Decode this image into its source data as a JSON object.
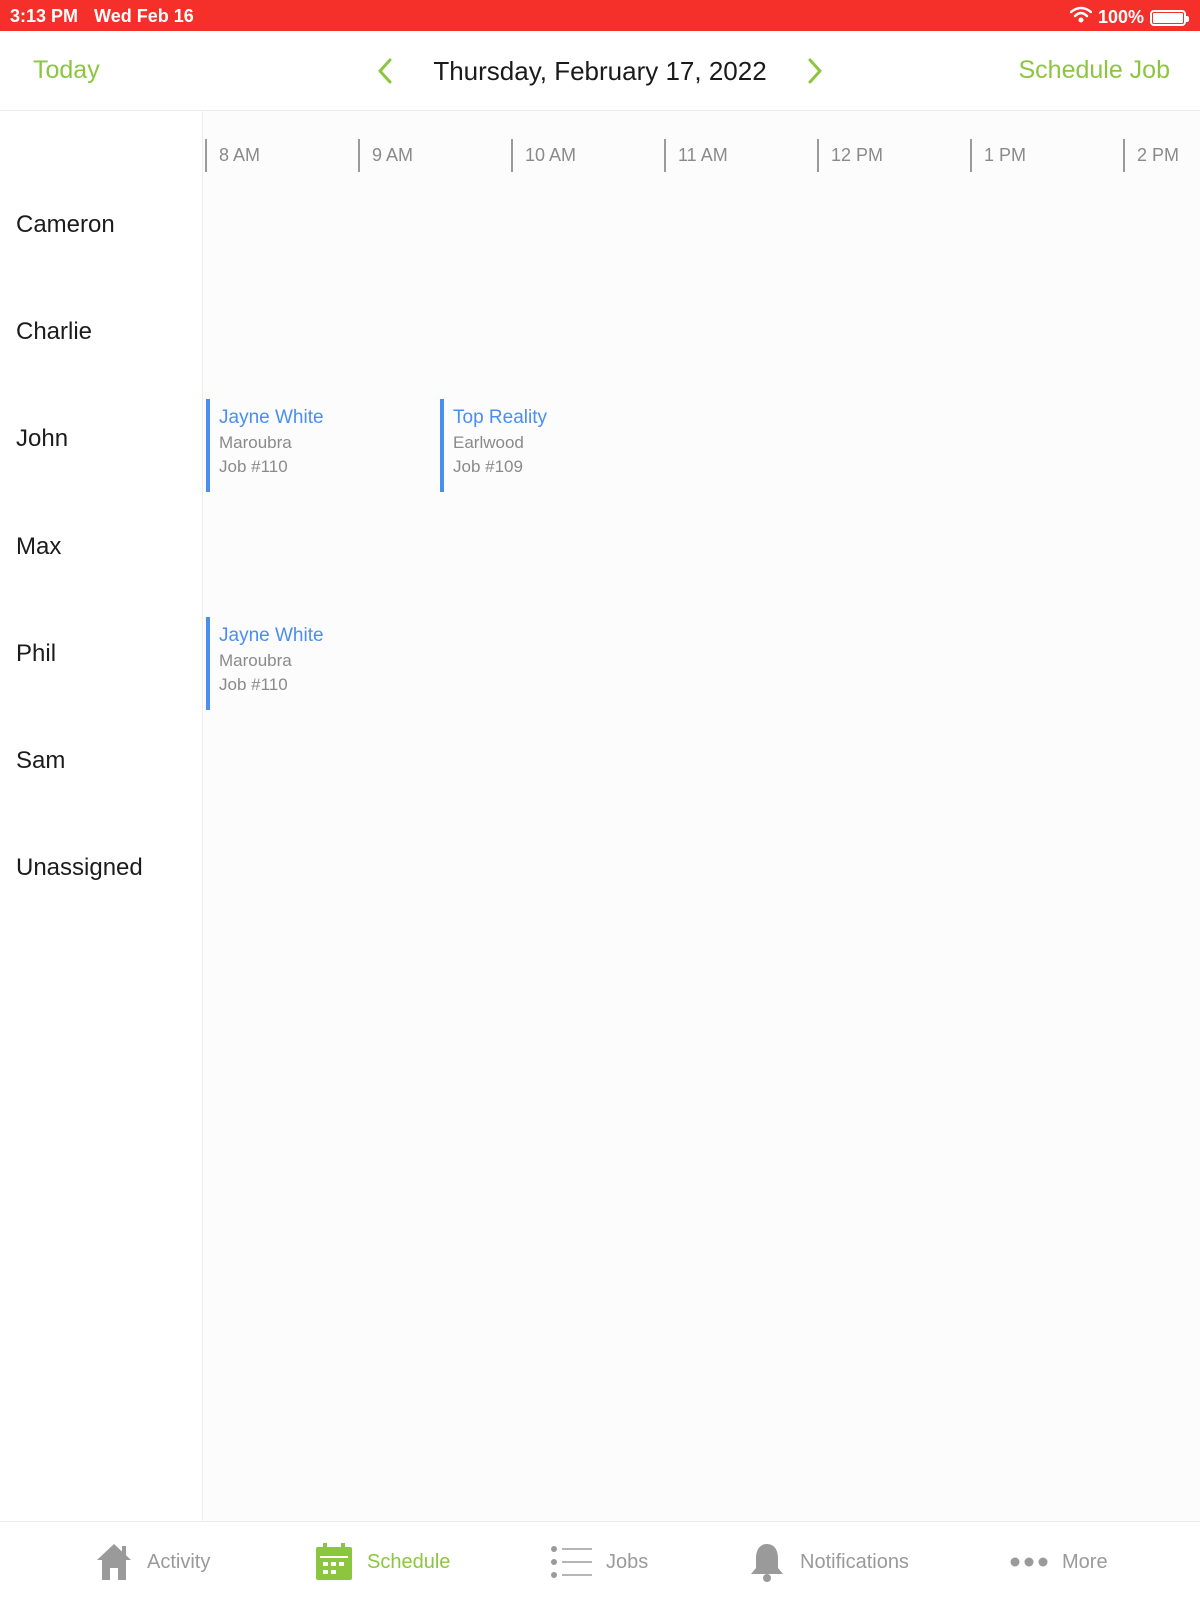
{
  "status_bar": {
    "time": "3:13 PM",
    "date": "Wed Feb 16",
    "battery": "100%"
  },
  "header": {
    "today_label": "Today",
    "date_title": "Thursday, February 17, 2022",
    "schedule_job_label": "Schedule Job"
  },
  "timeline": {
    "hours": [
      "8 AM",
      "9 AM",
      "10 AM",
      "11 AM",
      "12 PM",
      "1 PM",
      "2 PM"
    ]
  },
  "staff": [
    "Cameron",
    "Charlie",
    "John",
    "Max",
    "Phil",
    "Sam",
    "Unassigned"
  ],
  "jobs": [
    {
      "assignee": "John",
      "client": "Jayne White",
      "suburb": "Maroubra",
      "job_number": "Job #110"
    },
    {
      "assignee": "John",
      "client": "Top Reality",
      "suburb": "Earlwood",
      "job_number": "Job #109"
    },
    {
      "assignee": "Phil",
      "client": "Jayne White",
      "suburb": "Maroubra",
      "job_number": "Job #110"
    }
  ],
  "tabs": [
    {
      "label": "Activity",
      "icon": "house-icon",
      "active": false
    },
    {
      "label": "Schedule",
      "icon": "calendar-icon",
      "active": true
    },
    {
      "label": "Jobs",
      "icon": "list-icon",
      "active": false
    },
    {
      "label": "Notifications",
      "icon": "bell-icon",
      "active": false
    },
    {
      "label": "More",
      "icon": "ellipsis-icon",
      "active": false
    }
  ],
  "colors": {
    "status_bar": "#f5302a",
    "accent": "#8cc63f",
    "job": "#4a8ef0"
  }
}
